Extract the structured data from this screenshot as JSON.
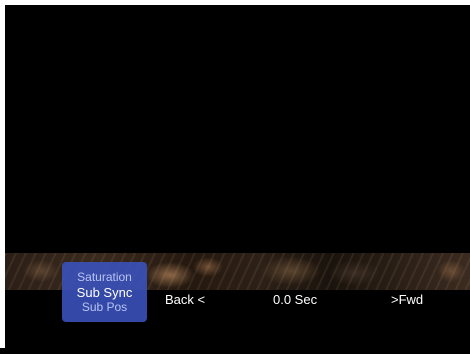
{
  "osd": {
    "menu_items": [
      {
        "label": "Saturation",
        "selected": false
      },
      {
        "label": "Sub Sync",
        "selected": true
      },
      {
        "label": "Sub Pos",
        "selected": false
      }
    ],
    "back_label": "Back  <",
    "value_label": "0.0 Sec",
    "fwd_label": ">Fwd"
  },
  "colors": {
    "menu_background": "#3a52be",
    "selected_text": "#ffffff",
    "unselected_text": "#b8c4f4",
    "screen_background": "#000000"
  }
}
